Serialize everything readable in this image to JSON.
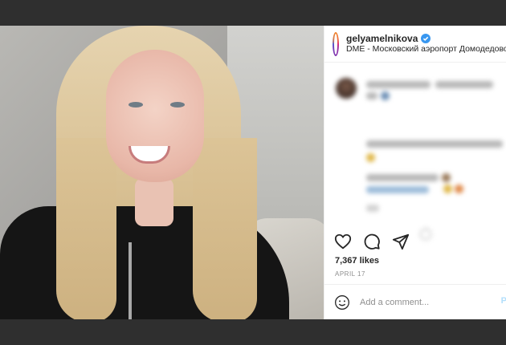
{
  "header": {
    "username": "gelyamelnikova",
    "location": "DME - Московский аэропорт Домодедово",
    "verified": true
  },
  "photo": {
    "icon": "selfie-photo"
  },
  "actions": {
    "icons": [
      "heart-icon",
      "comment-icon",
      "share-icon"
    ]
  },
  "post": {
    "likes": "7,367 likes",
    "date": "APRIL 17"
  },
  "comment_box": {
    "placeholder": "Add a comment...",
    "post_label": "P"
  },
  "colors": {
    "background": "#2f2f2f",
    "verified_blue": "#3897f0",
    "text": "#262626",
    "muted": "#8e8e8e"
  }
}
